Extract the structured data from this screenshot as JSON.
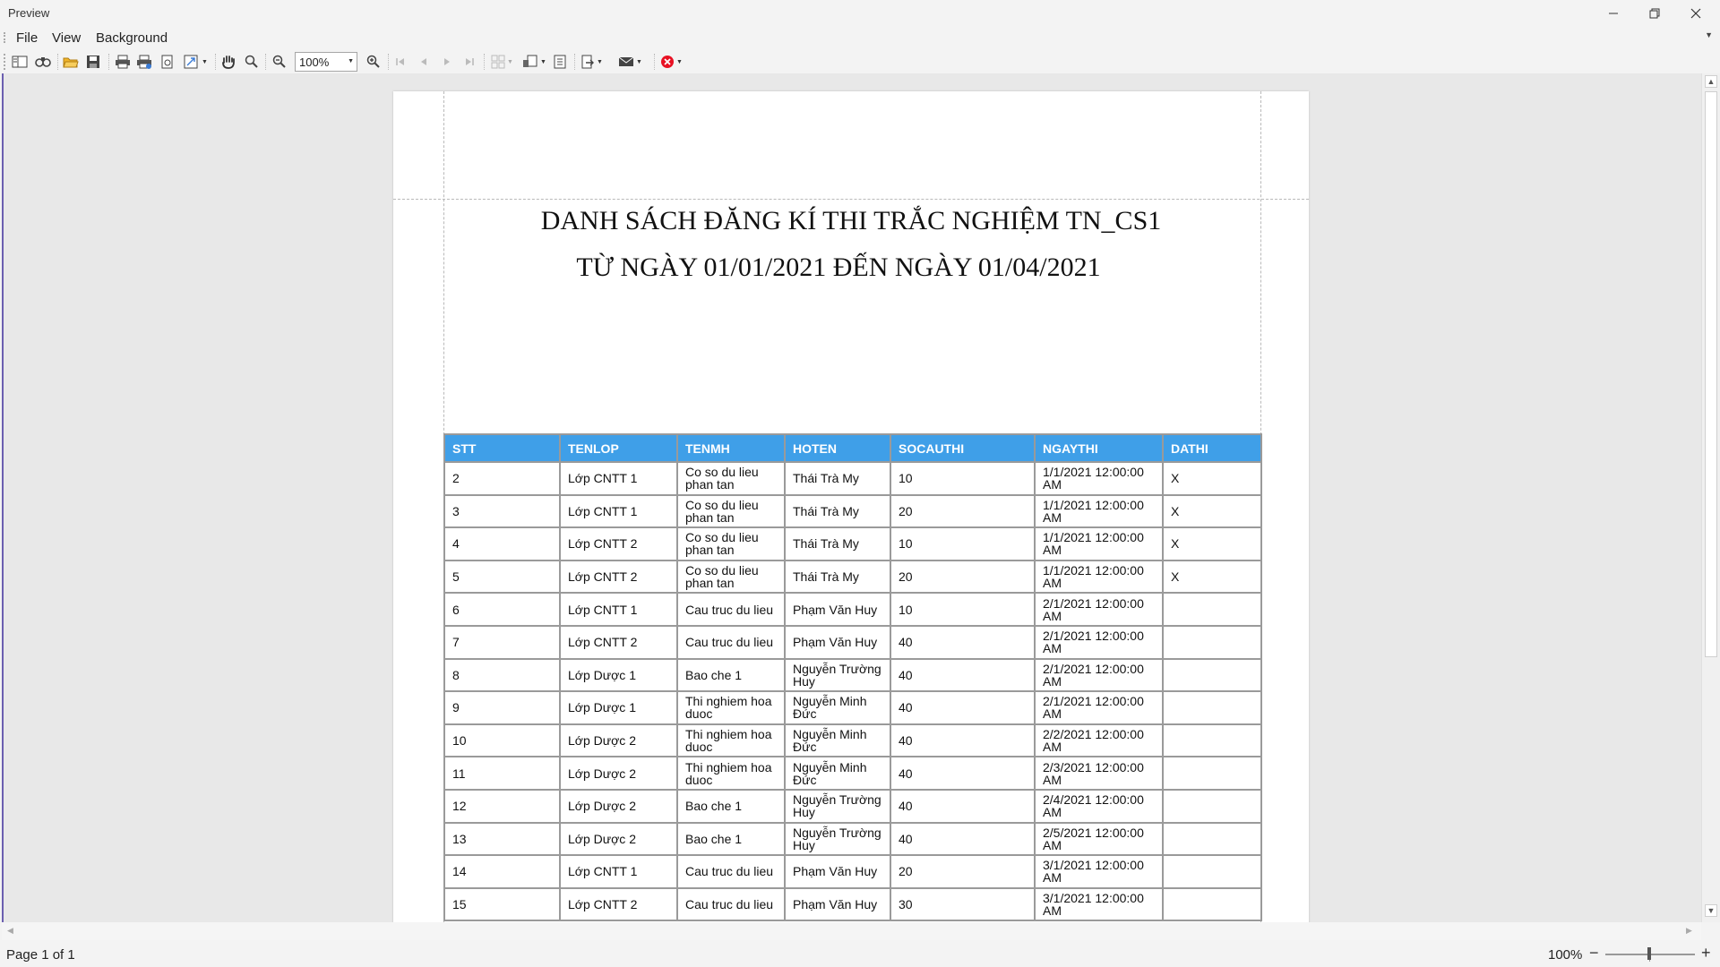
{
  "window": {
    "title": "Preview"
  },
  "menu": [
    "File",
    "View",
    "Background"
  ],
  "toolbar": {
    "zoom_value": "100%"
  },
  "report": {
    "title_line1": "DANH SÁCH ĐĂNG KÍ THI TRẮC NGHIỆM  TN_CS1",
    "title_line2": "TỪ NGÀY   01/01/2021   ĐẾN NGÀY 01/04/2021",
    "columns": [
      "STT",
      "TENLOP",
      "TENMH",
      "HOTEN",
      "SOCAUTHI",
      "NGAYTHI",
      "DATHI"
    ],
    "rows": [
      [
        "2",
        "Lớp CNTT 1",
        "Co so du lieu phan tan",
        "Thái Trà My",
        "10",
        "1/1/2021 12:00:00 AM",
        "X"
      ],
      [
        "3",
        "Lớp CNTT 1",
        "Co so du lieu phan tan",
        "Thái Trà My",
        "20",
        "1/1/2021 12:00:00 AM",
        "X"
      ],
      [
        "4",
        "Lớp CNTT 2",
        "Co so du lieu phan tan",
        "Thái Trà My",
        "10",
        "1/1/2021 12:00:00 AM",
        "X"
      ],
      [
        "5",
        "Lớp CNTT 2",
        "Co so du lieu phan tan",
        "Thái Trà My",
        "20",
        "1/1/2021 12:00:00 AM",
        "X"
      ],
      [
        "6",
        "Lớp CNTT 1",
        "Cau truc du lieu",
        "Phạm Văn Huy",
        "10",
        "2/1/2021 12:00:00 AM",
        ""
      ],
      [
        "7",
        "Lớp CNTT 2",
        "Cau truc du lieu",
        "Phạm Văn Huy",
        "40",
        "2/1/2021 12:00:00 AM",
        ""
      ],
      [
        "8",
        "Lớp Dược 1",
        "Bao che 1",
        "Nguyễn Trường Huy",
        "40",
        "2/1/2021 12:00:00 AM",
        ""
      ],
      [
        "9",
        "Lớp Dược 1",
        "Thi nghiem hoa duoc",
        "Nguyễn Minh Đức",
        "40",
        "2/1/2021 12:00:00 AM",
        ""
      ],
      [
        "10",
        "Lớp Dược 2",
        "Thi nghiem hoa duoc",
        "Nguyễn Minh Đức",
        "40",
        "2/2/2021 12:00:00 AM",
        ""
      ],
      [
        "11",
        "Lớp Dược 2",
        "Thi nghiem hoa duoc",
        "Nguyễn Minh Đức",
        "40",
        "2/3/2021 12:00:00 AM",
        ""
      ],
      [
        "12",
        "Lớp Dược 2",
        "Bao che 1",
        "Nguyễn Trường Huy",
        "40",
        "2/4/2021 12:00:00 AM",
        ""
      ],
      [
        "13",
        "Lớp Dược 2",
        "Bao che 1",
        "Nguyễn Trường Huy",
        "40",
        "2/5/2021 12:00:00 AM",
        ""
      ],
      [
        "14",
        "Lớp CNTT 1",
        "Cau truc du lieu",
        "Phạm Văn Huy",
        "20",
        "3/1/2021 12:00:00 AM",
        ""
      ],
      [
        "15",
        "Lớp CNTT 2",
        "Cau truc du lieu",
        "Phạm Văn Huy",
        "30",
        "3/1/2021 12:00:00 AM",
        ""
      ]
    ]
  },
  "status": {
    "page_info": "Page 1 of 1",
    "zoom_label": "100%",
    "minus": "−",
    "plus": "+"
  },
  "colors": {
    "header_bg": "#3f9fe8",
    "close_icon": "#e81123"
  }
}
